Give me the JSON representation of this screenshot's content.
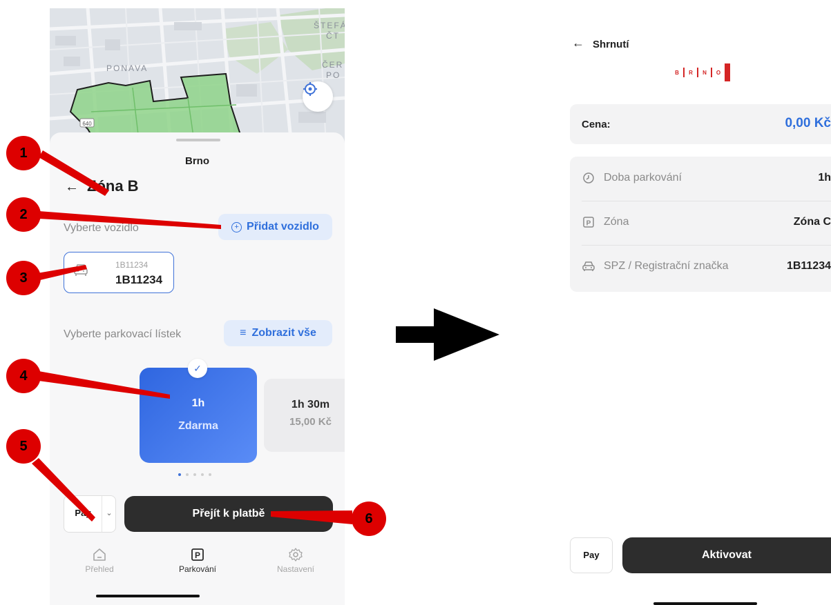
{
  "left_screen": {
    "map": {
      "labels": [
        "PONAVA",
        "ŠTEFÁ",
        "ČT",
        "ČER",
        "PO"
      ],
      "road_badge": "640"
    },
    "city": "Brno",
    "zone_title": "Zóna B",
    "vehicle_section": {
      "label": "Vyberte vozidlo",
      "add_button": "Přidat vozidlo"
    },
    "vehicle": {
      "small_plate": "1B11234",
      "plate": "1B11234"
    },
    "ticket_section": {
      "label": "Vyberte parkovací lístek",
      "show_all_button": "Zobrazit vše"
    },
    "tickets": [
      {
        "duration": "1h",
        "price": "Zdarma",
        "selected": true
      },
      {
        "duration": "1h 30m",
        "price": "15,00 Kč",
        "selected": false
      }
    ],
    "pager": {
      "count": 5,
      "active": 1
    },
    "payment_method": "Pay",
    "checkout_button": "Přejít k platbě",
    "nav": [
      {
        "label": "Přehled",
        "icon": "home-icon",
        "active": false
      },
      {
        "label": "Parkování",
        "icon": "parking-icon",
        "active": true
      },
      {
        "label": "Nastavení",
        "icon": "gear-icon",
        "active": false
      }
    ]
  },
  "annotations": [
    "1",
    "2",
    "3",
    "4",
    "5",
    "6"
  ],
  "right_screen": {
    "title": "Shrnutí",
    "logo_letters": [
      "B",
      "R",
      "N",
      "O"
    ],
    "price": {
      "label": "Cena:",
      "value": "0,00 Kč"
    },
    "details": [
      {
        "icon": "clock-icon",
        "label": "Doba parkování",
        "value": "1h"
      },
      {
        "icon": "parking-icon",
        "label": "Zóna",
        "value": "Zóna C"
      },
      {
        "icon": "car-icon",
        "label": "SPZ / Registrační značka",
        "value": "1B11234"
      }
    ],
    "payment_method": "Pay",
    "activate_button": "Aktivovat"
  },
  "colors": {
    "accent": "#2f6fdc",
    "marker_red": "#dd0000",
    "button_dark": "#2d2d2d",
    "logo_red": "#d42525",
    "map_zone_green": "#8fd48a"
  }
}
